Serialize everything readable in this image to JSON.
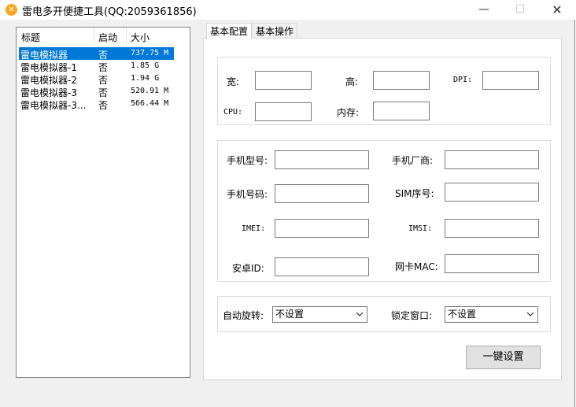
{
  "window": {
    "title": "雷电多开便捷工具(QQ:2059361856)"
  },
  "list": {
    "headers": [
      "标题",
      "启动",
      "大小"
    ],
    "rows": [
      [
        "雷电模拟器",
        "否",
        "737.75 M"
      ],
      [
        "雷电模拟器-1",
        "否",
        "1.85 G"
      ],
      [
        "雷电模拟器-2",
        "否",
        "1.94 G"
      ],
      [
        "雷电模拟器-3",
        "否",
        "520.91 M"
      ],
      [
        "雷电模拟器-3...",
        "否",
        "566.44 M"
      ]
    ]
  },
  "tabs": [
    "基本配置",
    "基本操作"
  ],
  "config": {
    "width_label": "宽:",
    "height_label": "高:",
    "dpi_label": "DPI:",
    "cpu_label": "CPU:",
    "memory_label": "内存:",
    "phone_model_label": "手机型号:",
    "manufacturer_label": "手机厂商:",
    "phone_number_label": "手机号码:",
    "sim_label": "SIM序号:",
    "imei_label": "IMEI:",
    "imsi_label": "IMSI:",
    "android_id_label": "安卓ID:",
    "mac_label": "网卡MAC:",
    "auto_rotate_label": "自动旋转:",
    "auto_rotate_value": "不设置",
    "lock_window_label": "锁定窗口:",
    "lock_window_value": "不设置",
    "apply_button": "一键设置"
  }
}
